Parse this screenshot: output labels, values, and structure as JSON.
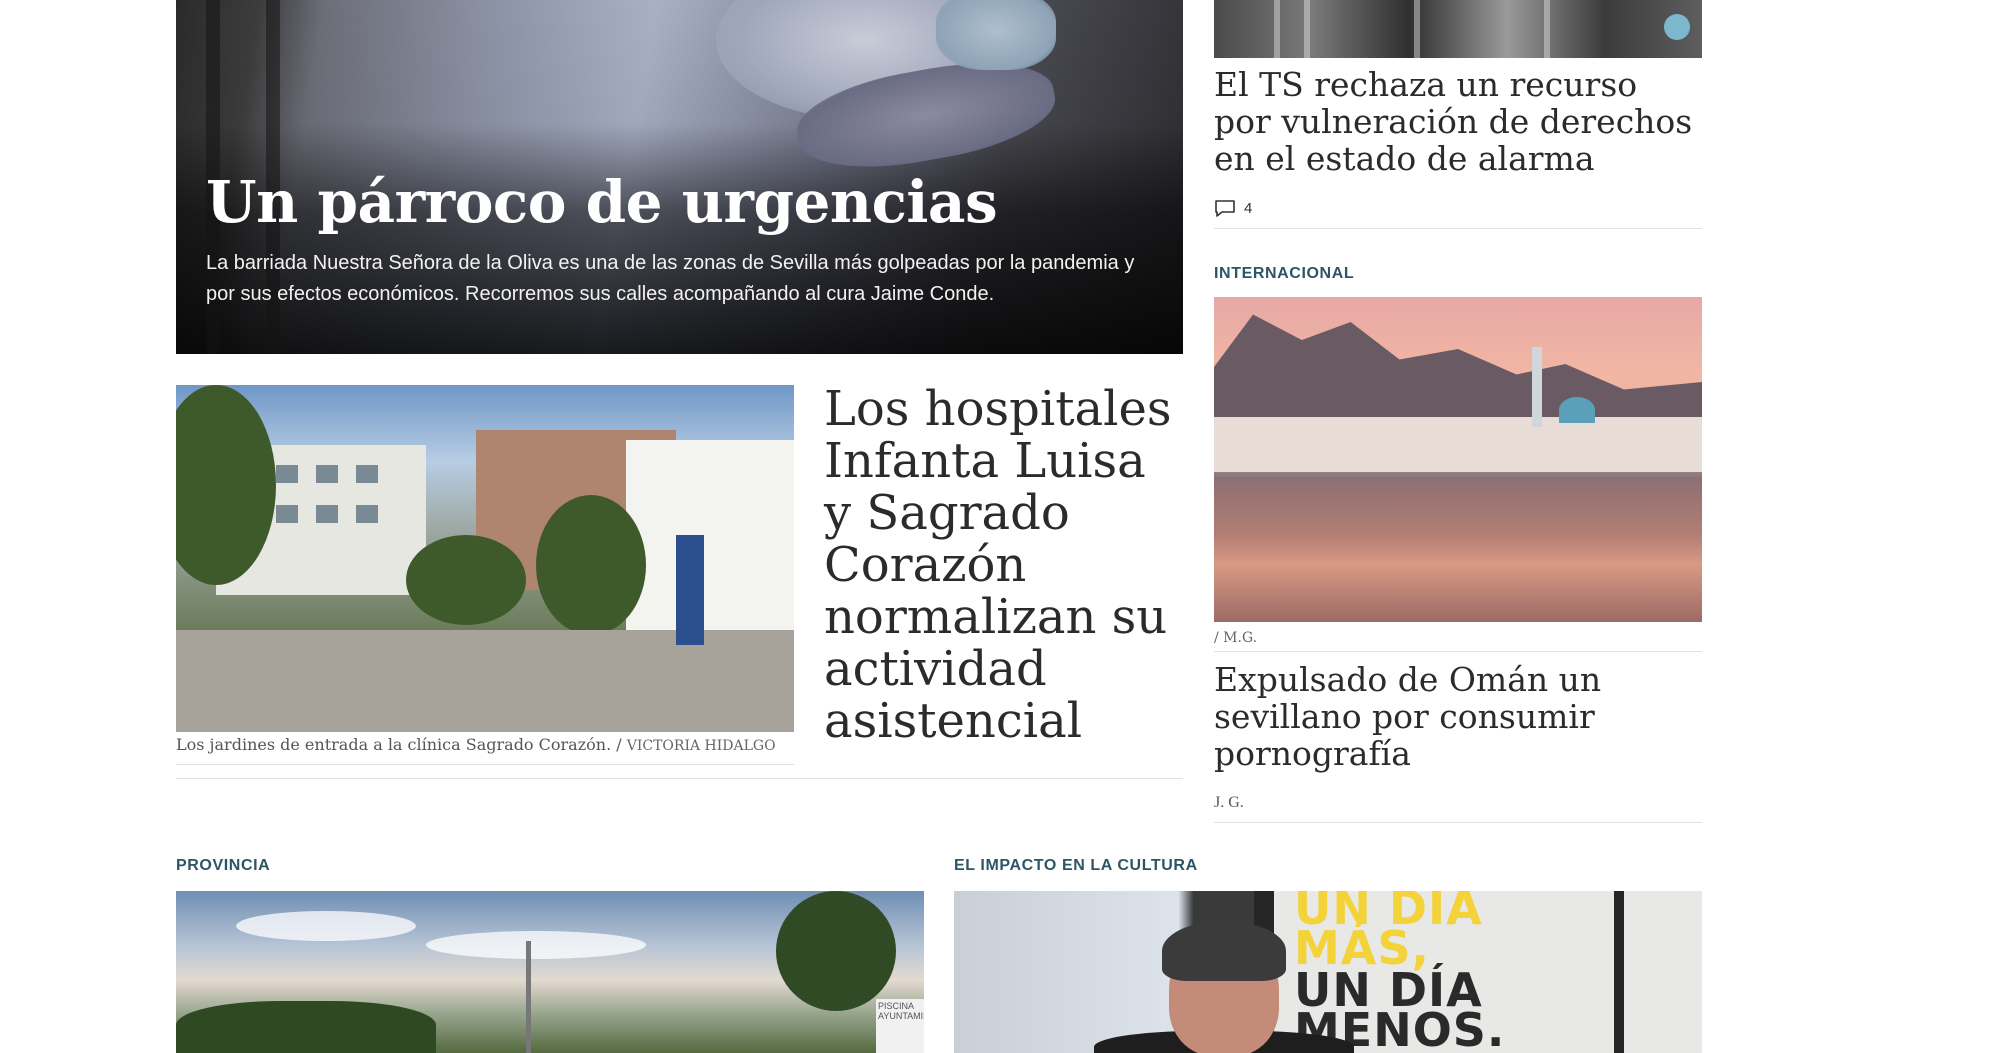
{
  "hero": {
    "title": "Un párroco de urgencias",
    "subtitle": "La barriada Nuestra Señora de la Oliva es una de las zonas de Sevilla más golpeadas por la pandemia y por sus efectos económicos. Recorremos sus calles acompañando al cura Jaime Conde."
  },
  "hospital_story": {
    "title": "Los hospitales Infanta Luisa y Sagrado Corazón normalizan su actividad asistencial",
    "caption": "Los jardines de entrada a la clínica Sagrado Corazón. / ",
    "credit": "VICTORIA HIDALGO"
  },
  "ts_story": {
    "title": "El TS rechaza un recurso por vulneración de derechos en el estado de alarma",
    "comments_icon": "comment-icon",
    "comment_count": "4"
  },
  "international": {
    "label": "INTERNACIONAL",
    "photo_credit": "/ M.G.",
    "title": "Expulsado de Omán un sevillano por consumir pornografía",
    "author": "J. G."
  },
  "province": {
    "label": "PROVINCIA",
    "sign_text": "PISCINA AYUNTAMIENTO"
  },
  "culture": {
    "label": "EL IMPACTO EN LA CULTURA",
    "poster_line1": "UN DÍA",
    "poster_line2": "MÁS,",
    "poster_line3": "UN DÍA",
    "poster_line4": "MENOS."
  },
  "colors": {
    "section_label": "#2d5566",
    "headline": "#2b2b2b",
    "divider": "#e2e2e2"
  }
}
